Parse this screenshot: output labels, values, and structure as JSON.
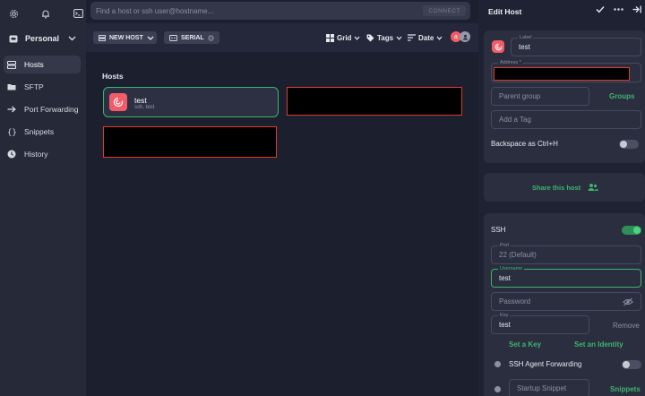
{
  "sidebar": {
    "vault_label": "Personal",
    "items": [
      {
        "label": "Hosts",
        "icon": "hosts-icon"
      },
      {
        "label": "SFTP",
        "icon": "folder-icon"
      },
      {
        "label": "Port Forwarding",
        "icon": "port-forwarding-icon"
      },
      {
        "label": "Snippets",
        "icon": "snippets-icon"
      },
      {
        "label": "History",
        "icon": "history-icon"
      }
    ]
  },
  "search": {
    "placeholder": "Find a host or ssh user@hostname...",
    "connect_label": "CONNECT"
  },
  "toolbar": {
    "new_host_label": "NEW HOST",
    "serial_label": "SERIAL",
    "grid_label": "Grid",
    "tags_label": "Tags",
    "date_label": "Date",
    "avatar_letter": "a"
  },
  "hosts_section": {
    "title": "Hosts",
    "hosts": [
      {
        "name": "test",
        "details": "ssh, test"
      }
    ]
  },
  "edit_host": {
    "title": "Edit Host",
    "label_caption": "Label",
    "label_value": "test",
    "address_caption": "Address *",
    "parent_group_placeholder": "Parent group",
    "groups_link": "Groups",
    "add_tag_placeholder": "Add a Tag",
    "backspace_label": "Backspace as Ctrl+H",
    "share_label": "Share this host",
    "ssh_label": "SSH",
    "port_caption": "Port",
    "port_value": "22 (Default)",
    "username_caption": "Username",
    "username_value": "test",
    "password_placeholder": "Password",
    "key_caption": "Key",
    "key_value": "test",
    "remove_label": "Remove",
    "set_key_link": "Set a Key",
    "set_identity_link": "Set an Identity",
    "agent_forwarding_label": "SSH Agent Forwarding",
    "startup_snippet_placeholder": "Startup Snippet",
    "snippets_link": "Snippets"
  },
  "colors": {
    "accent": "#3fb46d",
    "host_icon": "#f25c69",
    "redaction_border": "#e03a2f"
  }
}
